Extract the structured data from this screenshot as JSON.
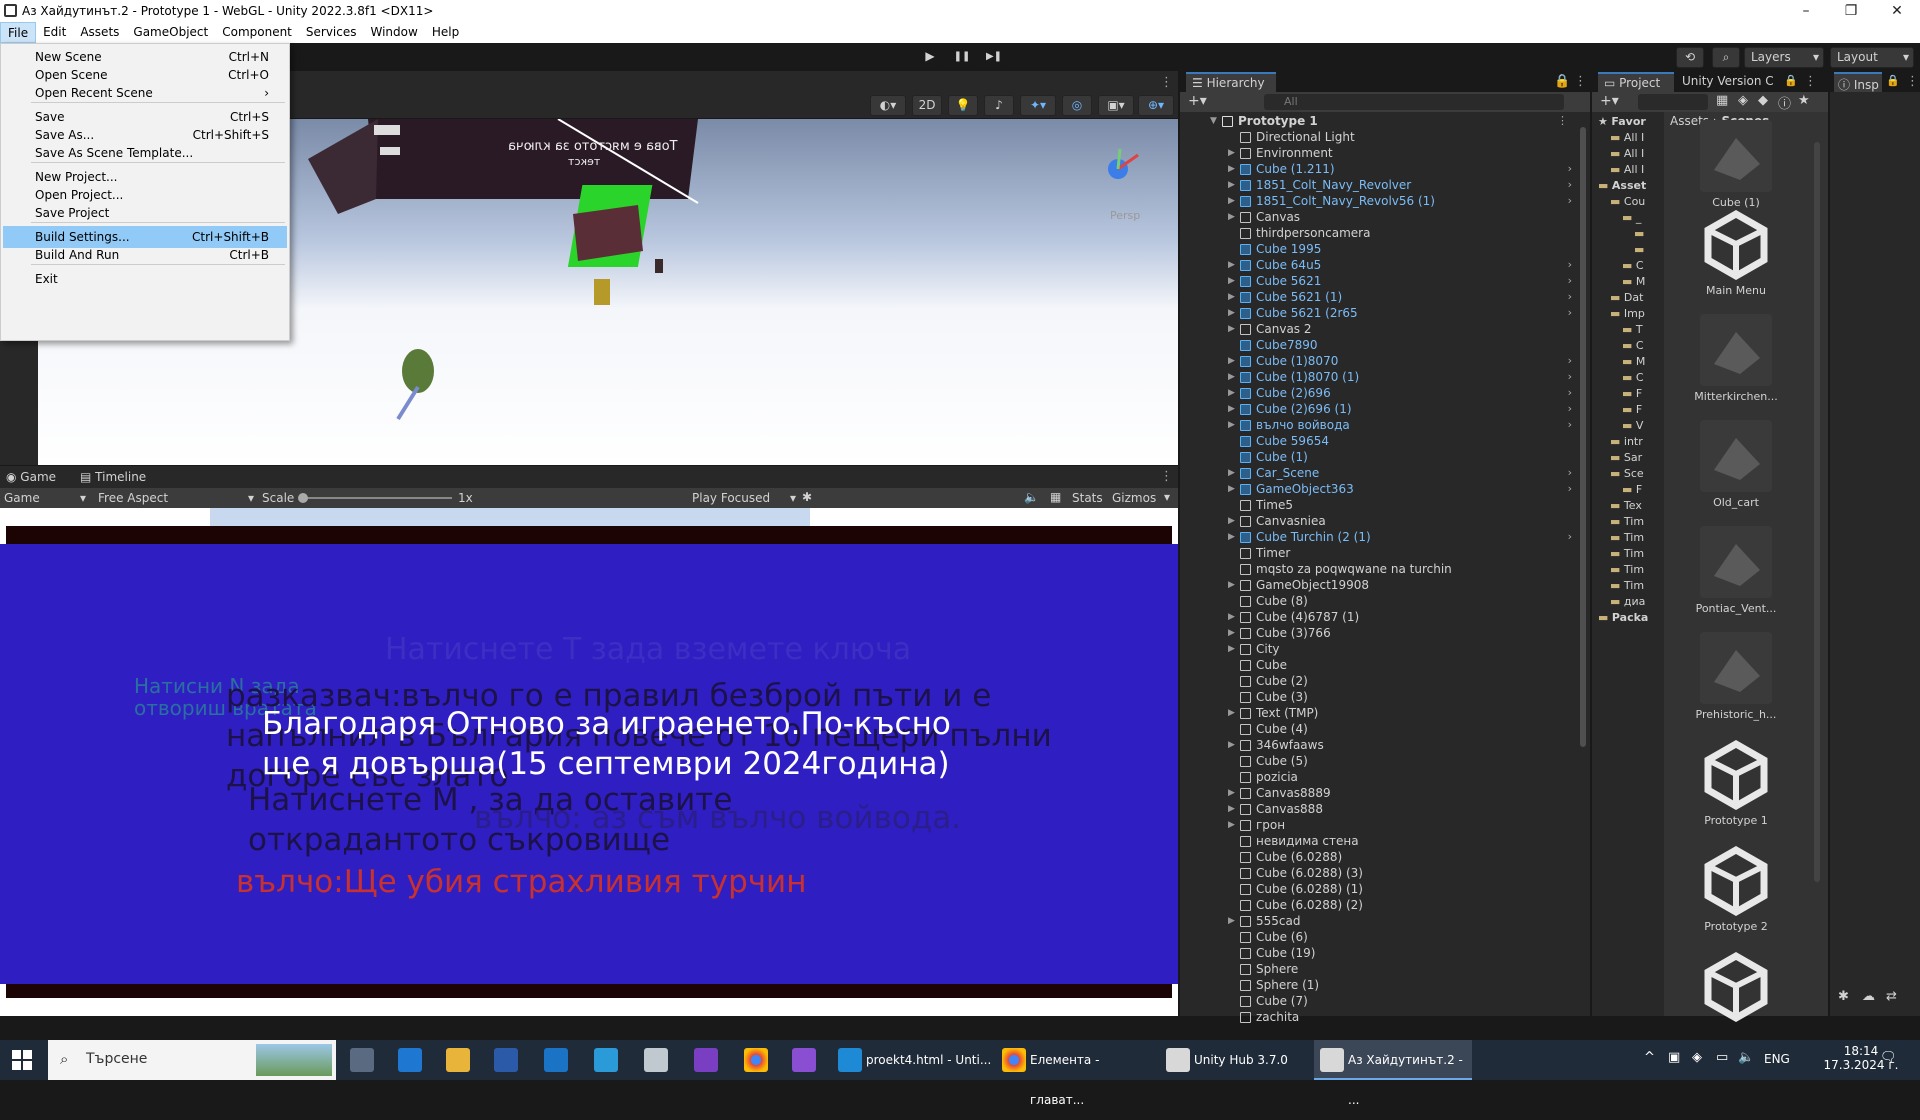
{
  "window": {
    "title": "Аз Хайдутинът.2 - Prototype 1 - WebGL - Unity 2022.3.8f1 <DX11>",
    "min": "–",
    "max": "❐",
    "close": "✕"
  },
  "menubar": [
    "File",
    "Edit",
    "Assets",
    "GameObject",
    "Component",
    "Services",
    "Window",
    "Help"
  ],
  "toolbar": {
    "layers": "Layers",
    "layout": "Layout",
    "play": "▶",
    "pause": "❚❚",
    "step": "▶❚"
  },
  "file_menu": [
    {
      "label": "New Scene",
      "shortcut": "Ctrl+N"
    },
    {
      "label": "Open Scene",
      "shortcut": "Ctrl+O"
    },
    {
      "label": "Open Recent Scene",
      "shortcut": "›"
    },
    {
      "label": "Save",
      "shortcut": "Ctrl+S"
    },
    {
      "label": "Save As...",
      "shortcut": "Ctrl+Shift+S"
    },
    {
      "label": "Save As Scene Template...",
      "shortcut": ""
    },
    {
      "label": "New Project...",
      "shortcut": ""
    },
    {
      "label": "Open Project...",
      "shortcut": ""
    },
    {
      "label": "Save Project",
      "shortcut": ""
    },
    {
      "label": "Build Settings...",
      "shortcut": "Ctrl+Shift+B"
    },
    {
      "label": "Build And Run",
      "shortcut": "Ctrl+B"
    },
    {
      "label": "Exit",
      "shortcut": ""
    }
  ],
  "scene": {
    "btn_2d": "2D",
    "persp": "Persp",
    "sign_line1": "Това е мястото за ключа",
    "sign_line2": "текст"
  },
  "game_tabs": {
    "game": "Game",
    "timeline": "Timeline"
  },
  "game_ctrl": {
    "display": "Game",
    "aspect": "Free Aspect",
    "scale_label": "Scale",
    "scale_value": "1x",
    "play_mode": "Play Focused",
    "stats": "Stats",
    "gizmos": "Gizmos"
  },
  "game_texts": {
    "t1": "Натиснете Т зада вземете ключа",
    "t2a": "Натисни N зада",
    "t2b": "отвориш вратата",
    "t3a": "разказвач:вълчо го е правил безброй пъти и е",
    "t3b": "напълнил в България повече от 10 пещери пълни",
    "t3c": "догоре със злато",
    "t4a": "Благодаря  Отново за играенето.По-късно",
    "t4b": "ще я довърша(15 септември 2024година)",
    "t5a": "Натиснете М , за да оставите",
    "t5b": "открадантото съкровище",
    "t6": "вълчо: аз съм вълчо войвода.",
    "t7": "вълчо:Ще убия страхливия турчин"
  },
  "hierarchy": {
    "tab": "Hierarchy",
    "search_placeholder": "All",
    "root": "Prototype 1",
    "items": [
      {
        "name": "Directional Light",
        "prefab": false,
        "expand": false
      },
      {
        "name": "Environment",
        "prefab": false,
        "expand": true
      },
      {
        "name": "Cube (1.211)",
        "prefab": true,
        "expand": true
      },
      {
        "name": "1851_Colt_Navy_Revolver",
        "prefab": true,
        "expand": true
      },
      {
        "name": "1851_Colt_Navy_Revolv56 (1)",
        "prefab": true,
        "expand": true
      },
      {
        "name": "Canvas",
        "prefab": false,
        "expand": true
      },
      {
        "name": "thirdpersoncamera",
        "prefab": false,
        "expand": false
      },
      {
        "name": "Cube 1995",
        "prefab": true,
        "expand": false
      },
      {
        "name": "Cube 64u5",
        "prefab": true,
        "expand": true
      },
      {
        "name": "Cube 5621",
        "prefab": true,
        "expand": true
      },
      {
        "name": "Cube 5621 (1)",
        "prefab": true,
        "expand": true
      },
      {
        "name": "Cube 5621 (2r65",
        "prefab": true,
        "expand": true
      },
      {
        "name": "Canvas 2",
        "prefab": false,
        "expand": true
      },
      {
        "name": "Cube7890",
        "prefab": true,
        "expand": false
      },
      {
        "name": "Cube (1)8070",
        "prefab": true,
        "expand": true
      },
      {
        "name": "Cube (1)8070 (1)",
        "prefab": true,
        "expand": true
      },
      {
        "name": "Cube (2)696",
        "prefab": true,
        "expand": true
      },
      {
        "name": "Cube (2)696 (1)",
        "prefab": true,
        "expand": true
      },
      {
        "name": "вълчо войвода",
        "prefab": true,
        "expand": true
      },
      {
        "name": "Cube 59654",
        "prefab": true,
        "expand": false
      },
      {
        "name": "Cube (1)",
        "prefab": true,
        "expand": false
      },
      {
        "name": "Car_Scene",
        "prefab": true,
        "expand": true
      },
      {
        "name": "GameObject363",
        "prefab": true,
        "expand": true
      },
      {
        "name": "Time5",
        "prefab": false,
        "expand": false
      },
      {
        "name": "Canvasniea",
        "prefab": false,
        "expand": true
      },
      {
        "name": "Cube Turchin (2 (1)",
        "prefab": true,
        "expand": true
      },
      {
        "name": "Timer",
        "prefab": false,
        "expand": false
      },
      {
        "name": "mqsto za poqwqwane na turchin",
        "prefab": false,
        "expand": false
      },
      {
        "name": "GameObject19908",
        "prefab": false,
        "expand": true
      },
      {
        "name": "Cube (8)",
        "prefab": false,
        "expand": false
      },
      {
        "name": "Cube (4)6787 (1)",
        "prefab": false,
        "expand": true
      },
      {
        "name": "Cube (3)766",
        "prefab": false,
        "expand": true
      },
      {
        "name": "City",
        "prefab": false,
        "expand": true
      },
      {
        "name": "Cube",
        "prefab": false,
        "expand": false
      },
      {
        "name": "Cube (2)",
        "prefab": false,
        "expand": false
      },
      {
        "name": "Cube (3)",
        "prefab": false,
        "expand": false
      },
      {
        "name": "Text (TMP)",
        "prefab": false,
        "expand": true
      },
      {
        "name": "Cube (4)",
        "prefab": false,
        "expand": false
      },
      {
        "name": "346wfaaws",
        "prefab": false,
        "expand": true
      },
      {
        "name": "Cube (5)",
        "prefab": false,
        "expand": false
      },
      {
        "name": "pozicia",
        "prefab": false,
        "expand": false
      },
      {
        "name": "Canvas8889",
        "prefab": false,
        "expand": true
      },
      {
        "name": "Canvas888",
        "prefab": false,
        "expand": true
      },
      {
        "name": "грон",
        "prefab": false,
        "expand": true
      },
      {
        "name": "невидима стена",
        "prefab": false,
        "expand": false
      },
      {
        "name": "Cube (6.0288)",
        "prefab": false,
        "expand": false
      },
      {
        "name": "Cube (6.0288) (3)",
        "prefab": false,
        "expand": false
      },
      {
        "name": "Cube (6.0288) (1)",
        "prefab": false,
        "expand": false
      },
      {
        "name": "Cube (6.0288) (2)",
        "prefab": false,
        "expand": false
      },
      {
        "name": "555cad",
        "prefab": false,
        "expand": true
      },
      {
        "name": "Cube (6)",
        "prefab": false,
        "expand": false
      },
      {
        "name": "Cube (19)",
        "prefab": false,
        "expand": false
      },
      {
        "name": "Sphere",
        "prefab": false,
        "expand": false
      },
      {
        "name": "Sphere (1)",
        "prefab": false,
        "expand": false
      },
      {
        "name": "Cube (7)",
        "prefab": false,
        "expand": false
      },
      {
        "name": "zachita",
        "prefab": false,
        "expand": false
      }
    ]
  },
  "project": {
    "tab": "Project",
    "version_tab": "Unity Version C",
    "breadcrumb_root": "Assets",
    "breadcrumb_current": "Scenes",
    "tree": [
      {
        "label": "Favor",
        "indent": 0
      },
      {
        "label": "All I",
        "indent": 1
      },
      {
        "label": "All I",
        "indent": 1
      },
      {
        "label": "All I",
        "indent": 1
      },
      {
        "label": "Asset",
        "indent": 0
      },
      {
        "label": "Cou",
        "indent": 1
      },
      {
        "label": "_",
        "indent": 2
      },
      {
        "label": "",
        "indent": 3
      },
      {
        "label": "",
        "indent": 3
      },
      {
        "label": "C",
        "indent": 2
      },
      {
        "label": "M",
        "indent": 2
      },
      {
        "label": "Dat",
        "indent": 1
      },
      {
        "label": "Imp",
        "indent": 1
      },
      {
        "label": "T",
        "indent": 2
      },
      {
        "label": "C",
        "indent": 2
      },
      {
        "label": "M",
        "indent": 2
      },
      {
        "label": "C",
        "indent": 2
      },
      {
        "label": "F",
        "indent": 2
      },
      {
        "label": "F",
        "indent": 2
      },
      {
        "label": "V",
        "indent": 2
      },
      {
        "label": "intr",
        "indent": 1
      },
      {
        "label": "Sar",
        "indent": 1
      },
      {
        "label": "Sce",
        "indent": 1
      },
      {
        "label": "F",
        "indent": 2
      },
      {
        "label": "Tex",
        "indent": 1
      },
      {
        "label": "Tim",
        "indent": 1
      },
      {
        "label": "Tim",
        "indent": 1
      },
      {
        "label": "Tim",
        "indent": 1
      },
      {
        "label": "Tim",
        "indent": 1
      },
      {
        "label": "Tim",
        "indent": 1
      },
      {
        "label": "диа",
        "indent": 1
      },
      {
        "label": "Packa",
        "indent": 0
      }
    ],
    "assets": [
      "Cube (1)",
      "Main Menu",
      "Mitterkirchen...",
      "Old_cart",
      "Pontiac_Vent...",
      "Prehistoric_h...",
      "Prototype 1",
      "Prototype 2",
      ""
    ]
  },
  "inspector": {
    "tab": "Insp"
  },
  "taskbar": {
    "search": "Търсене",
    "apps": [
      {
        "label": "proekt4.html - Unti..."
      },
      {
        "label": "Елемента - глават..."
      },
      {
        "label": "Unity Hub 3.7.0"
      },
      {
        "label": "Аз Хайдутинът.2 - ..."
      }
    ],
    "lang": "ENG",
    "time": "18:14",
    "date": "17.3.2024 г."
  }
}
